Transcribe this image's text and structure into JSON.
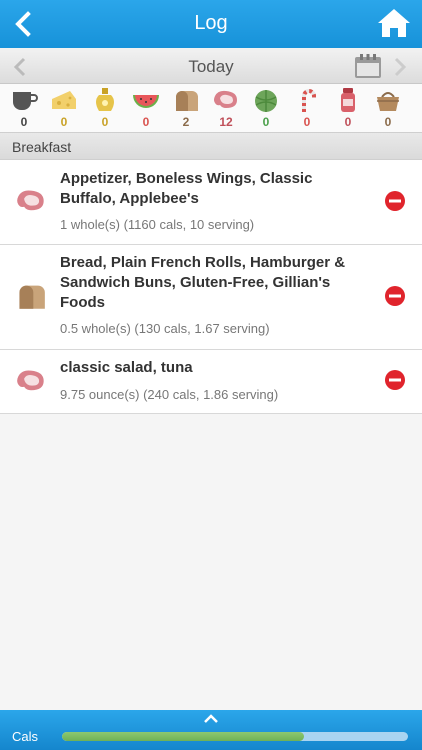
{
  "header": {
    "title": "Log",
    "back_icon": "chevron-left-icon",
    "home_icon": "home-icon"
  },
  "date_bar": {
    "label": "Today",
    "prev_icon": "chevron-left-icon",
    "calendar_icon": "calendar-icon",
    "next_icon": "chevron-right-icon"
  },
  "food_groups": [
    {
      "icon": "coffee-cup-icon",
      "count": "0",
      "color": "#444444"
    },
    {
      "icon": "cheese-icon",
      "count": "0",
      "color": "#c9a227"
    },
    {
      "icon": "oil-jar-icon",
      "count": "0",
      "color": "#c9a227"
    },
    {
      "icon": "watermelon-icon",
      "count": "0",
      "color": "#d9534f"
    },
    {
      "icon": "bread-icon",
      "count": "2",
      "color": "#8b6b4a"
    },
    {
      "icon": "meat-icon",
      "count": "12",
      "color": "#c0505a"
    },
    {
      "icon": "artichoke-icon",
      "count": "0",
      "color": "#4aa04a"
    },
    {
      "icon": "candy-cane-icon",
      "count": "0",
      "color": "#d9534f"
    },
    {
      "icon": "jar-icon",
      "count": "0",
      "color": "#c0505a"
    },
    {
      "icon": "basket-icon",
      "count": "0",
      "color": "#8b6b4a"
    }
  ],
  "section": {
    "title": "Breakfast"
  },
  "entries": [
    {
      "icon": "meat-icon",
      "name_lines": [
        "Appetizer, Boneless Wings, Classic",
        "Buffalo, Applebee's"
      ],
      "detail": "1 whole(s) (1160 cals, 10 serving)"
    },
    {
      "icon": "bread-icon",
      "name_lines": [
        "Bread, Plain French Rolls, Hamburger &",
        "Sandwich Buns, Gluten-Free, Gillian's",
        "Foods"
      ],
      "detail": "0.5 whole(s) (130 cals, 1.67 serving)"
    },
    {
      "icon": "meat-icon",
      "name_lines": [
        "classic salad, tuna"
      ],
      "detail": "9.75 ounce(s) (240 cals, 1.86 serving)"
    }
  ],
  "bottom_bar": {
    "label": "Cals",
    "progress": 0.7,
    "expand_icon": "chevron-up-icon"
  },
  "colors": {
    "accent": "#1a9ae0",
    "delete": "#e0242c",
    "progress": "#7cbd60"
  }
}
